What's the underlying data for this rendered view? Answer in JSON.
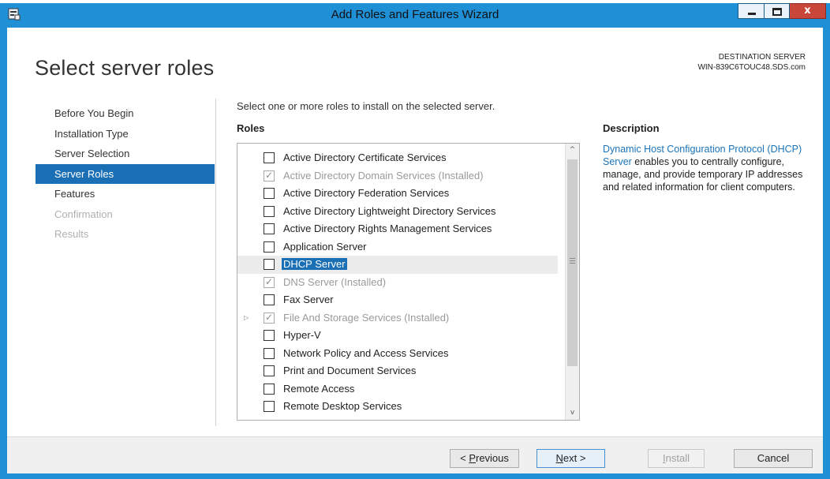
{
  "window": {
    "title": "Add Roles and Features Wizard",
    "controls": {
      "minimize": "minimize",
      "maximize": "maximize",
      "close": "x"
    }
  },
  "page": {
    "title": "Select server roles",
    "destination_label": "DESTINATION SERVER",
    "destination_server": "WIN-839C6TOUC48.SDS.com"
  },
  "nav": [
    {
      "label": "Before You Begin",
      "state": "normal"
    },
    {
      "label": "Installation Type",
      "state": "normal"
    },
    {
      "label": "Server Selection",
      "state": "normal"
    },
    {
      "label": "Server Roles",
      "state": "active"
    },
    {
      "label": "Features",
      "state": "normal"
    },
    {
      "label": "Confirmation",
      "state": "disabled"
    },
    {
      "label": "Results",
      "state": "disabled"
    }
  ],
  "main": {
    "instruction": "Select one or more roles to install on the selected server.",
    "roles_heading": "Roles",
    "roles": [
      {
        "label": "Active Directory Certificate Services",
        "checked": false,
        "installed": false,
        "expandable": false,
        "selected": false
      },
      {
        "label": "Active Directory Domain Services (Installed)",
        "checked": true,
        "installed": true,
        "expandable": false,
        "selected": false
      },
      {
        "label": "Active Directory Federation Services",
        "checked": false,
        "installed": false,
        "expandable": false,
        "selected": false
      },
      {
        "label": "Active Directory Lightweight Directory Services",
        "checked": false,
        "installed": false,
        "expandable": false,
        "selected": false
      },
      {
        "label": "Active Directory Rights Management Services",
        "checked": false,
        "installed": false,
        "expandable": false,
        "selected": false
      },
      {
        "label": "Application Server",
        "checked": false,
        "installed": false,
        "expandable": false,
        "selected": false
      },
      {
        "label": "DHCP Server",
        "checked": false,
        "installed": false,
        "expandable": false,
        "selected": true
      },
      {
        "label": "DNS Server (Installed)",
        "checked": true,
        "installed": true,
        "expandable": false,
        "selected": false
      },
      {
        "label": "Fax Server",
        "checked": false,
        "installed": false,
        "expandable": false,
        "selected": false
      },
      {
        "label": "File And Storage Services (Installed)",
        "checked": true,
        "installed": true,
        "expandable": true,
        "selected": false
      },
      {
        "label": "Hyper-V",
        "checked": false,
        "installed": false,
        "expandable": false,
        "selected": false
      },
      {
        "label": "Network Policy and Access Services",
        "checked": false,
        "installed": false,
        "expandable": false,
        "selected": false
      },
      {
        "label": "Print and Document Services",
        "checked": false,
        "installed": false,
        "expandable": false,
        "selected": false
      },
      {
        "label": "Remote Access",
        "checked": false,
        "installed": false,
        "expandable": false,
        "selected": false
      },
      {
        "label": "Remote Desktop Services",
        "checked": false,
        "installed": false,
        "expandable": false,
        "selected": false
      }
    ],
    "description_heading": "Description",
    "description_link": "Dynamic Host Configuration Protocol (DHCP) Server",
    "description_text": " enables you to centrally configure, manage, and provide temporary IP addresses and related information for client computers."
  },
  "footer": {
    "previous": {
      "prefix": "< ",
      "mnemonic": "P",
      "rest": "revious"
    },
    "next": {
      "mnemonic": "N",
      "rest": "ext >"
    },
    "install": {
      "mnemonic": "I",
      "rest": "nstall"
    },
    "cancel": "Cancel"
  },
  "colors": {
    "window_frame": "#1f8fd6",
    "nav_active": "#1a6fb5",
    "link": "#1a73b8",
    "close_button": "#c9473a"
  },
  "icons": {
    "app": "server-manager-icon",
    "checkmark": "✓",
    "expander": "▷",
    "scroll_up": "^",
    "scroll_down": "v"
  }
}
